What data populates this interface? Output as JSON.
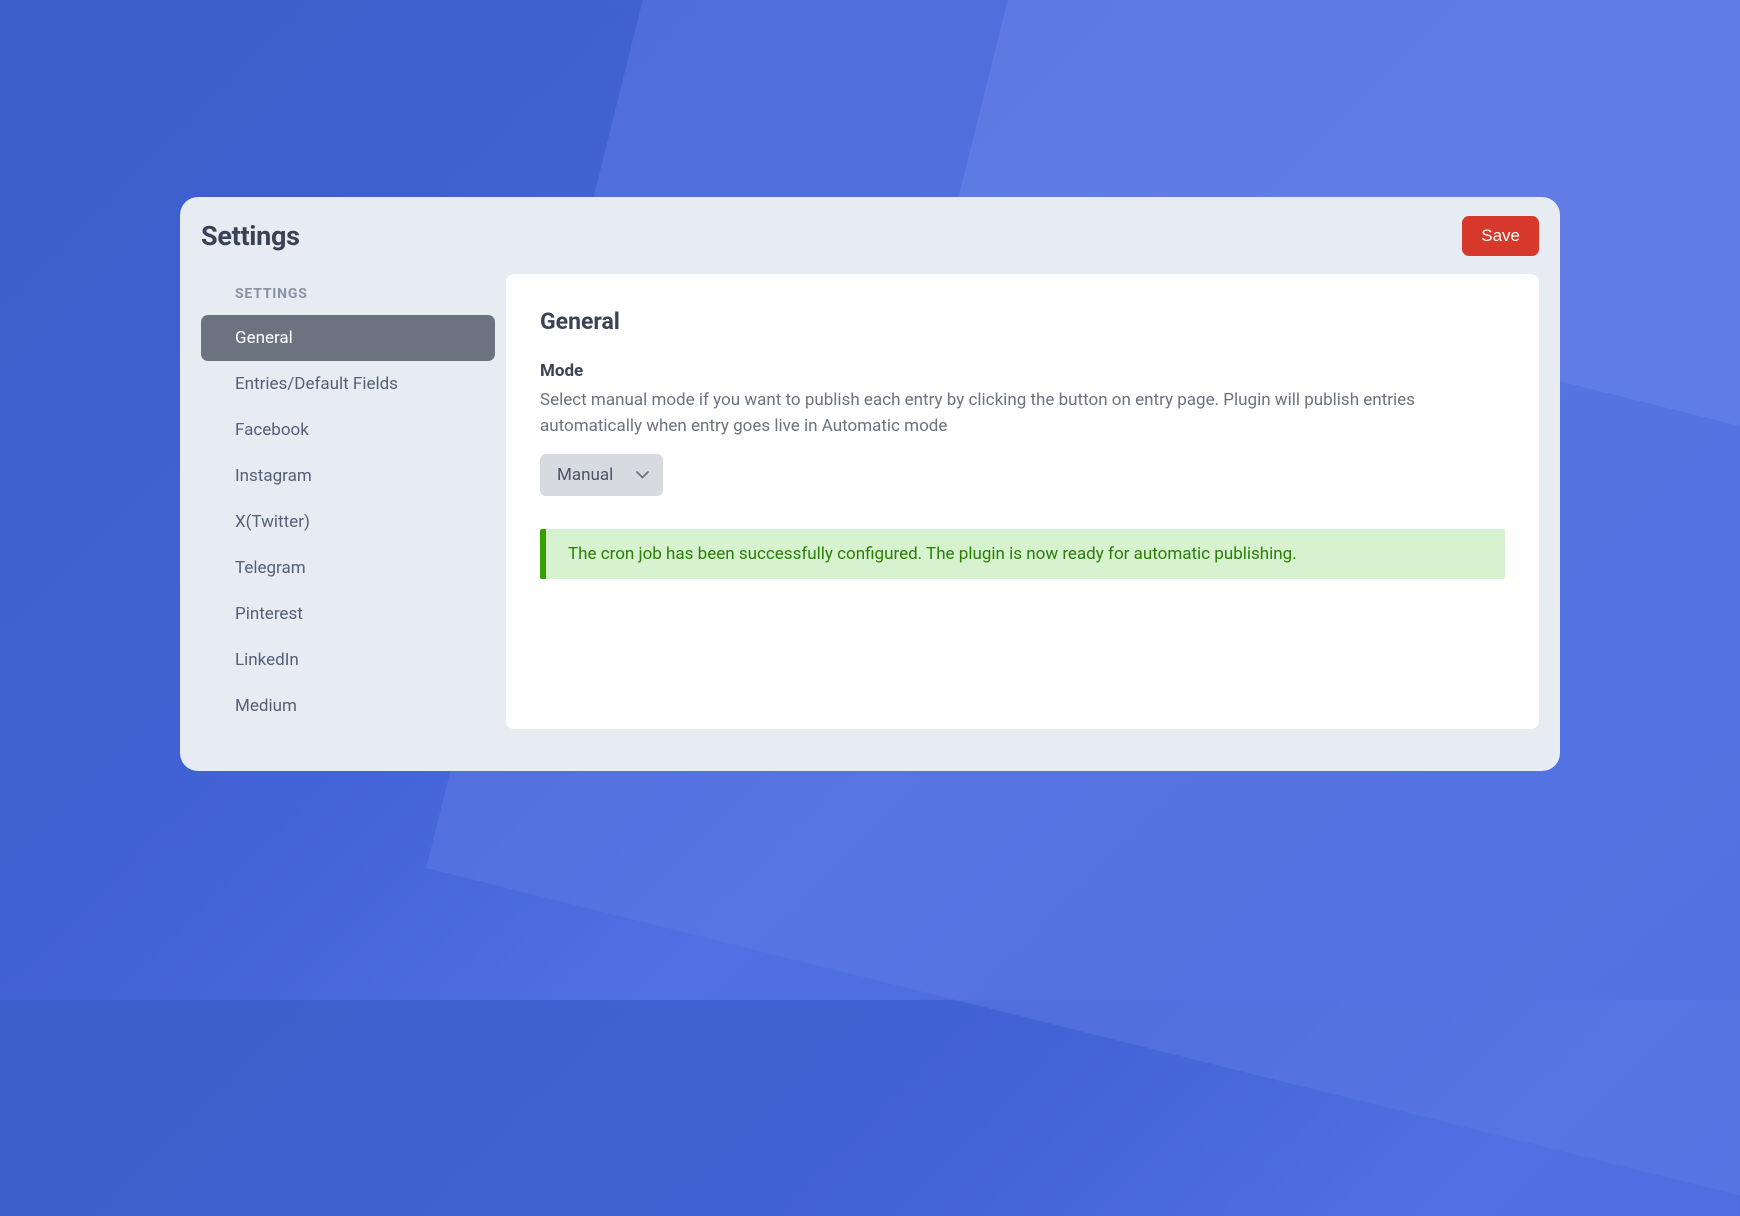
{
  "header": {
    "title": "Settings",
    "save_label": "Save"
  },
  "sidebar": {
    "heading": "SETTINGS",
    "items": [
      {
        "label": "General",
        "active": true
      },
      {
        "label": "Entries/Default Fields",
        "active": false
      },
      {
        "label": "Facebook",
        "active": false
      },
      {
        "label": "Instagram",
        "active": false
      },
      {
        "label": "X(Twitter)",
        "active": false
      },
      {
        "label": "Telegram",
        "active": false
      },
      {
        "label": "Pinterest",
        "active": false
      },
      {
        "label": "LinkedIn",
        "active": false
      },
      {
        "label": "Medium",
        "active": false
      }
    ]
  },
  "main": {
    "section_title": "General",
    "mode": {
      "label": "Mode",
      "description": "Select manual mode if you want to publish each entry by clicking the button on entry page. Plugin will publish entries automatically when entry goes live in Automatic mode",
      "selected": "Manual"
    },
    "alert": {
      "message": "The cron job has been successfully configured. The plugin is now ready for automatic publishing."
    }
  }
}
